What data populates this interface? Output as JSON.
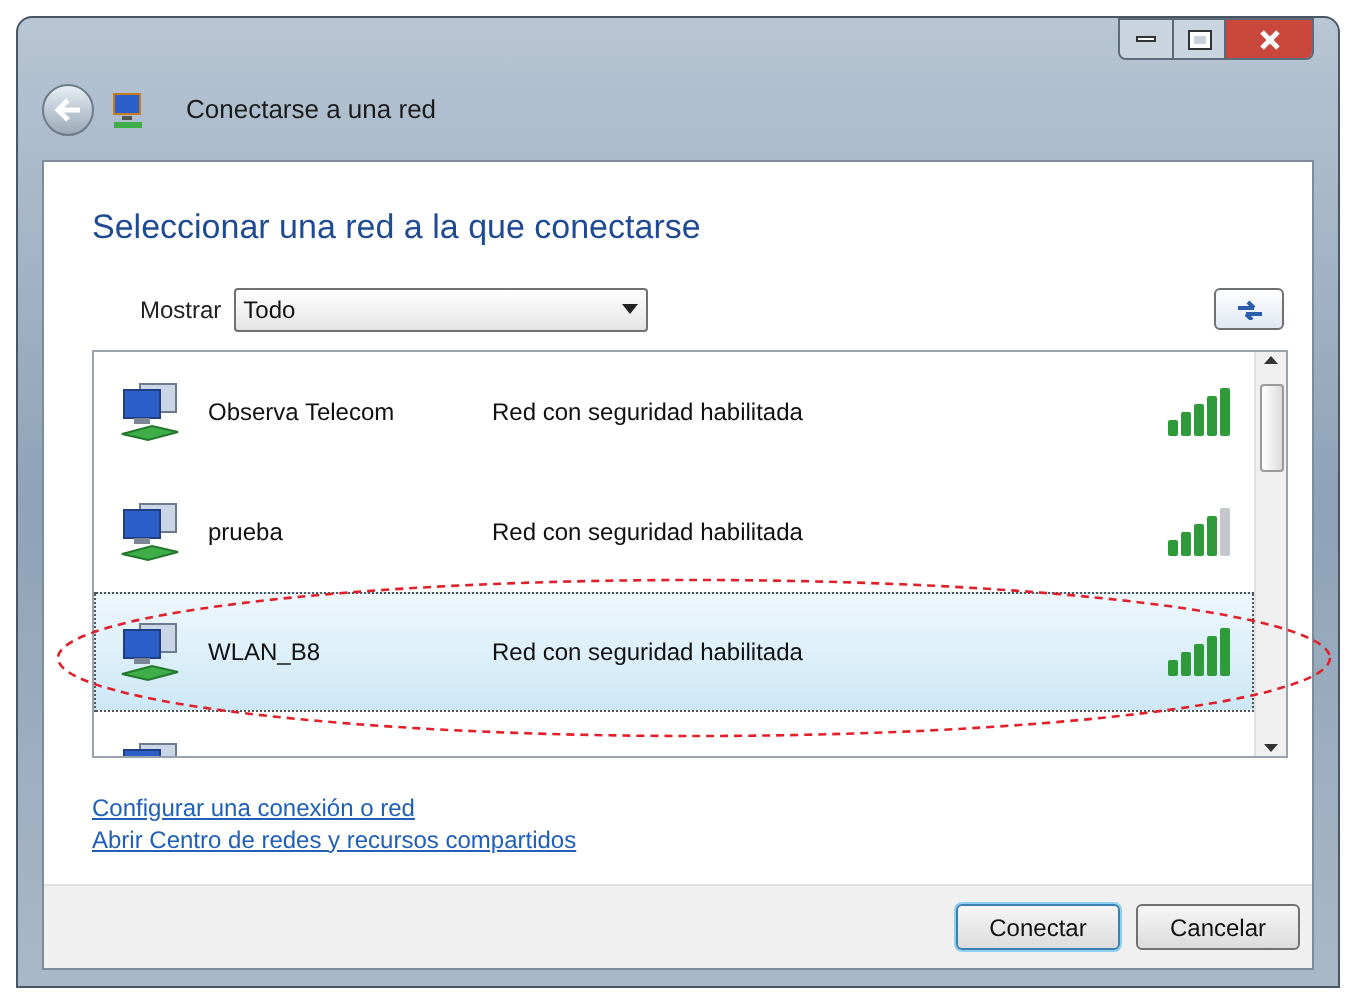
{
  "window": {
    "title": "Conectarse a una red"
  },
  "heading": "Seleccionar una red a la que conectarse",
  "filter": {
    "label": "Mostrar",
    "value": "Todo"
  },
  "networks": [
    {
      "name": "Observa Telecom",
      "security": "Red con seguridad habilitada",
      "signal_full": true,
      "selected": false
    },
    {
      "name": "prueba",
      "security": "Red con seguridad habilitada",
      "signal_full": false,
      "selected": false
    },
    {
      "name": "WLAN_B8",
      "security": "Red con seguridad habilitada",
      "signal_full": true,
      "selected": true
    },
    {
      "selected": false
    }
  ],
  "links": [
    "Configurar una conexión o red",
    "Abrir Centro de redes y recursos compartidos"
  ],
  "buttons": [
    {
      "label": "Conectar",
      "default": true
    },
    {
      "label": "Cancelar",
      "default": false
    }
  ]
}
